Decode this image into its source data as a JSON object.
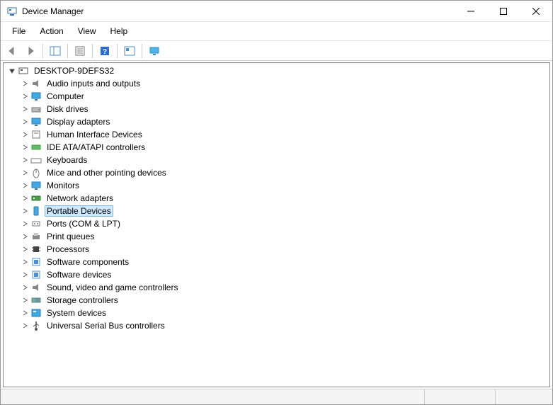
{
  "window": {
    "title": "Device Manager"
  },
  "menu": {
    "file": "File",
    "action": "Action",
    "view": "View",
    "help": "Help"
  },
  "tree": {
    "root": "DESKTOP-9DEFS32",
    "children": [
      {
        "label": "Audio inputs and outputs",
        "icon": "speaker"
      },
      {
        "label": "Computer",
        "icon": "monitor"
      },
      {
        "label": "Disk drives",
        "icon": "drive"
      },
      {
        "label": "Display adapters",
        "icon": "monitor"
      },
      {
        "label": "Human Interface Devices",
        "icon": "hid"
      },
      {
        "label": "IDE ATA/ATAPI controllers",
        "icon": "controller"
      },
      {
        "label": "Keyboards",
        "icon": "keyboard"
      },
      {
        "label": "Mice and other pointing devices",
        "icon": "mouse"
      },
      {
        "label": "Monitors",
        "icon": "monitor"
      },
      {
        "label": "Network adapters",
        "icon": "network"
      },
      {
        "label": "Portable Devices",
        "icon": "portable",
        "selected": true
      },
      {
        "label": "Ports (COM & LPT)",
        "icon": "port"
      },
      {
        "label": "Print queues",
        "icon": "printer"
      },
      {
        "label": "Processors",
        "icon": "cpu"
      },
      {
        "label": "Software components",
        "icon": "sw"
      },
      {
        "label": "Software devices",
        "icon": "sw"
      },
      {
        "label": "Sound, video and game controllers",
        "icon": "speaker"
      },
      {
        "label": "Storage controllers",
        "icon": "storage"
      },
      {
        "label": "System devices",
        "icon": "system"
      },
      {
        "label": "Universal Serial Bus controllers",
        "icon": "usb"
      }
    ]
  }
}
